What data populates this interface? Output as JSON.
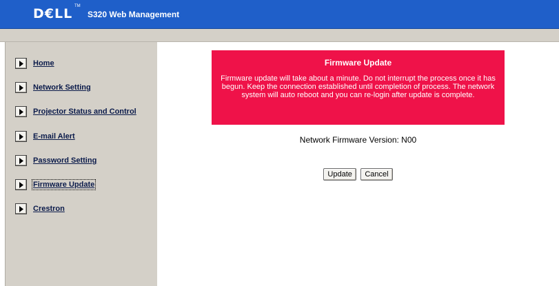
{
  "header": {
    "logo_text": "D€LL",
    "logo_tm": "TM",
    "title": "S320 Web Management",
    "background_color": "#1f5fc9"
  },
  "sidebar": {
    "items": [
      {
        "label": "Home",
        "icon": "arrow-right-icon"
      },
      {
        "label": "Network Setting",
        "icon": "arrow-right-icon"
      },
      {
        "label": "Projector Status and Control",
        "icon": "arrow-right-icon"
      },
      {
        "label": "E-mail Alert",
        "icon": "arrow-right-icon"
      },
      {
        "label": "Password Setting",
        "icon": "arrow-right-icon"
      },
      {
        "label": "Firmware Update",
        "icon": "arrow-right-icon",
        "current": true
      },
      {
        "label": "Crestron",
        "icon": "arrow-right-icon"
      }
    ]
  },
  "main": {
    "banner": {
      "title": "Firmware Update",
      "text": "Firmware update will take about a minute. Do not interrupt the process once it has begun. Keep the connection established until completion of process. The network system will auto reboot and you can re-login after update is complete.",
      "color": "#ef1249"
    },
    "firmware_version_text": "Network Firmware Version: N00",
    "update_button": "Update",
    "cancel_button": "Cancel"
  }
}
